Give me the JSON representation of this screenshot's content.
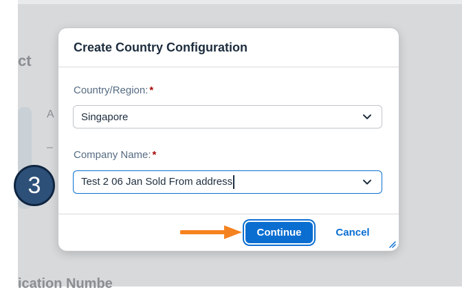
{
  "background": {
    "heading_fragment": "ct",
    "letter_fragment": "A",
    "dash_fragment": "–",
    "bottom_fragment": "ication Numbe"
  },
  "dialog": {
    "title": "Create Country Configuration",
    "fields": [
      {
        "label": "Country/Region:",
        "required_mark": "*",
        "value": "Singapore",
        "focused": false
      },
      {
        "label": "Company Name:",
        "required_mark": "*",
        "value": "Test 2 06 Jan Sold From address",
        "focused": true
      }
    ],
    "buttons": {
      "continue_label": "Continue",
      "cancel_label": "Cancel"
    }
  },
  "annotation": {
    "step_number": "3",
    "arrow_color": "#f58220"
  },
  "colors": {
    "accent": "#0a6ed1",
    "required": "#aa0808",
    "step_badge": "#2d5079"
  },
  "icons": [
    "chevron-down-icon",
    "resize-handle-icon",
    "arrow-right-icon"
  ]
}
